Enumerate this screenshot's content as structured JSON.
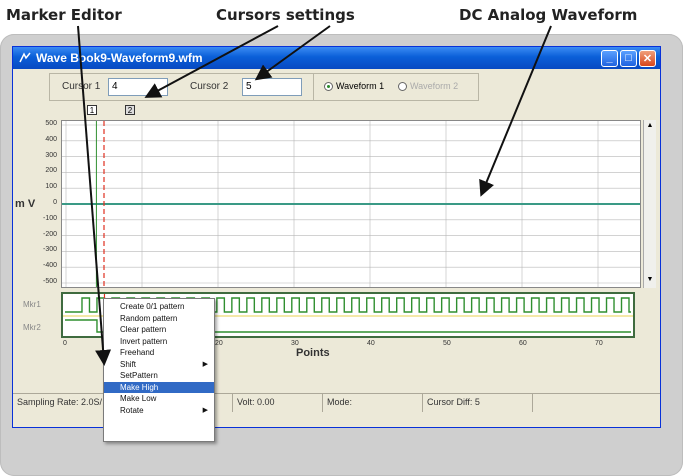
{
  "callouts": {
    "marker_editor": "Marker Editor",
    "cursors_settings": "Cursors settings",
    "dc_analog_waveform": "DC Analog Waveform"
  },
  "window": {
    "title": "Wave Book9-Waveform9.wfm",
    "minimize_glyph": "_",
    "maximize_glyph": "□",
    "close_glyph": "✕"
  },
  "toolbar": {
    "cursor1_label": "Cursor 1",
    "cursor1_value": "4",
    "cursor2_label": "Cursor 2",
    "cursor2_value": "5",
    "waveform1_label": "Waveform 1",
    "waveform2_label": "Waveform 2"
  },
  "cursors": {
    "tag1": "1",
    "tag2": "2",
    "cursor1_x": 4,
    "cursor2_x": 5
  },
  "plot": {
    "ylabel": "m V",
    "y_ticks": [
      "500",
      "400",
      "300",
      "200",
      "100",
      "0",
      "-100",
      "-200",
      "-300",
      "-400",
      "-500"
    ],
    "xlabel": "Points",
    "x_ticks": [
      "0",
      "10",
      "20",
      "30",
      "40",
      "50",
      "60",
      "70"
    ],
    "waveform_level_mv": 0,
    "colors": {
      "waveform": "#3a9a86",
      "grid": "#b8b8b8",
      "cursor": "#e03020",
      "marker": "#2f8f2f"
    }
  },
  "markers": {
    "mkr1": "Mkr1",
    "mkr2": "Mkr2"
  },
  "scrollbar": {
    "up": "▲",
    "down": "▼"
  },
  "status": {
    "sampling_rate": "Sampling Rate: 2.0S/",
    "volt": "Volt: 0.00",
    "mode": "Mode:",
    "cursor_diff": "Cursor Diff: 5"
  },
  "context_menu": {
    "items": [
      {
        "label": "Create 0/1 pattern",
        "submenu": ""
      },
      {
        "label": "Random pattern",
        "submenu": ""
      },
      {
        "label": "Clear pattern",
        "submenu": ""
      },
      {
        "label": "Invert pattern",
        "submenu": ""
      },
      {
        "label": "Freehand",
        "submenu": ""
      },
      {
        "label": "Shift",
        "submenu": "▶"
      },
      {
        "label": "SetPattern",
        "submenu": ""
      },
      {
        "label": "Make High",
        "submenu": ""
      },
      {
        "label": "Make Low",
        "submenu": ""
      },
      {
        "label": "Rotate",
        "submenu": "▶"
      }
    ],
    "highlighted_index": 7
  }
}
